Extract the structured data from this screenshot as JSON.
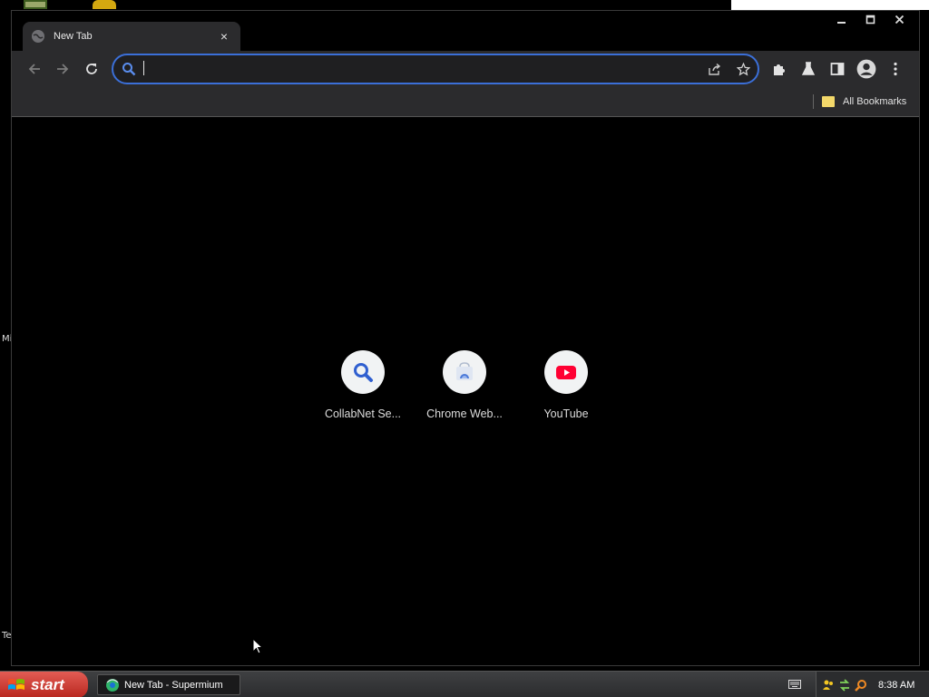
{
  "desktop": {
    "side_text_1": "Mi",
    "side_text_2": "Te"
  },
  "browser": {
    "tab": {
      "title": "New Tab",
      "favicon": "globe-icon",
      "close_glyph": "×"
    },
    "window_controls": [
      "minimize-icon",
      "maximize-icon",
      "close-icon"
    ],
    "toolbar": {
      "back": "arrow-left-icon",
      "forward": "arrow-right-icon",
      "reload": "reload-icon",
      "omnibox": {
        "value": "",
        "placeholder": ""
      },
      "actions": [
        "share-icon",
        "star-icon"
      ],
      "tools": [
        "puzzle-icon",
        "flask-icon",
        "side-panel-icon",
        "profile-icon",
        "more-vertical-icon"
      ]
    },
    "bookmarks_bar": {
      "all_bookmarks_label": "All Bookmarks"
    },
    "new_tab_page": {
      "shortcuts": [
        {
          "label": "CollabNet Se...",
          "icon": "search-magnifier-icon"
        },
        {
          "label": "Chrome Web...",
          "icon": "chrome-web-store-icon"
        },
        {
          "label": "YouTube",
          "icon": "youtube-icon"
        }
      ]
    }
  },
  "taskbar": {
    "start_label": "start",
    "task_item_label": "New Tab - Supermium",
    "clock": "8:38 AM"
  },
  "colors": {
    "accent": "#3b6fd8",
    "toolbar_bg": "#2b2b2d",
    "youtube_red": "#ff0033",
    "start_red": "#c9372f"
  }
}
